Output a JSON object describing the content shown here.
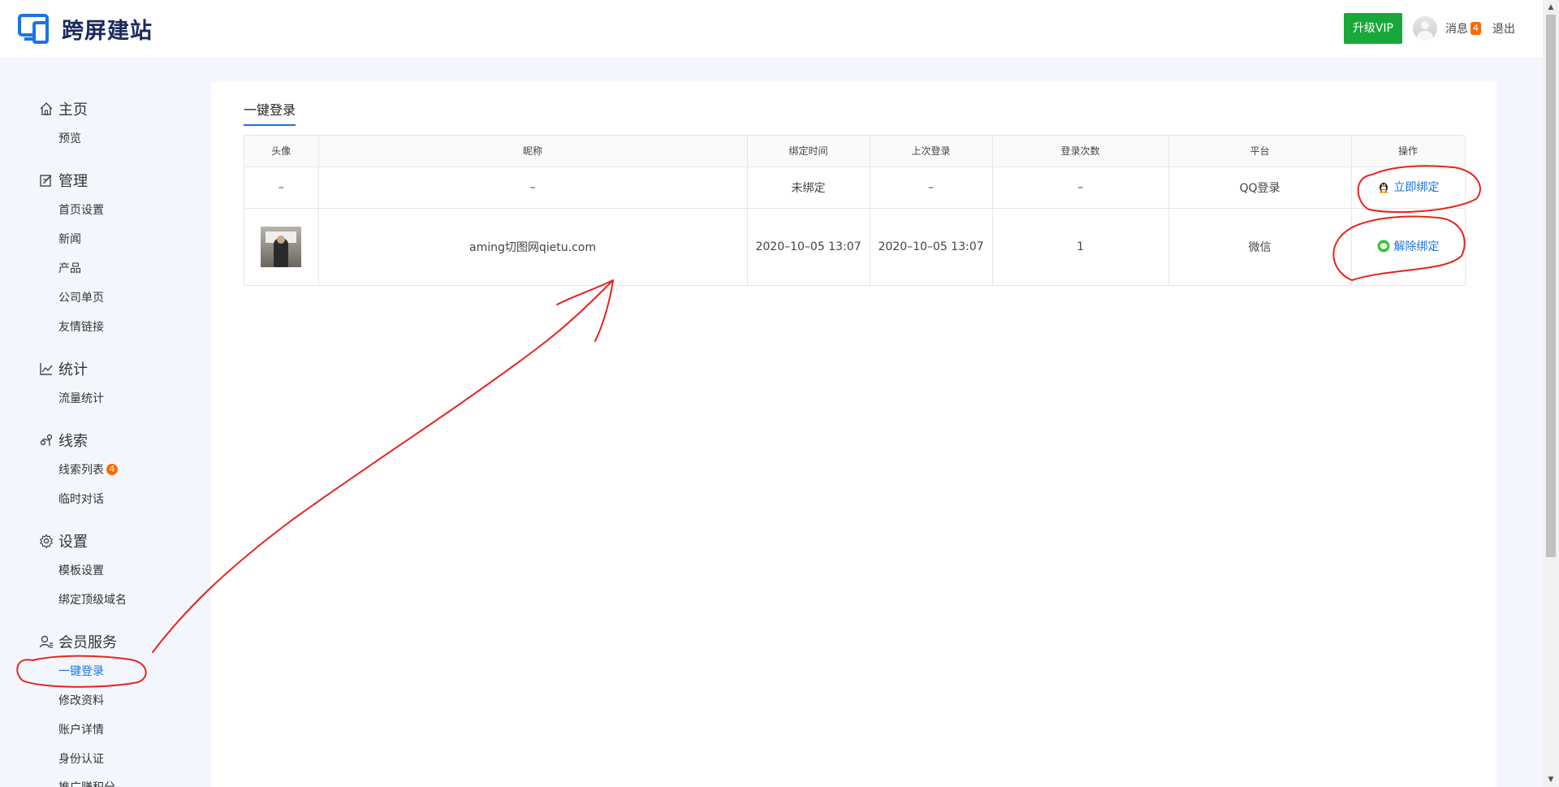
{
  "brand": {
    "name": "跨屏建站"
  },
  "header": {
    "vip_label": "升级VIP",
    "messages_label": "消息",
    "messages_count": "4",
    "logout_label": "退出"
  },
  "sidebar": {
    "groups": [
      {
        "title": "主页",
        "icon": "home-icon",
        "items": [
          "预览"
        ]
      },
      {
        "title": "管理",
        "icon": "edit-icon",
        "items": [
          "首页设置",
          "新闻",
          "产品",
          "公司单页",
          "友情链接"
        ]
      },
      {
        "title": "统计",
        "icon": "chart-line-icon",
        "items": [
          "流量统计"
        ]
      },
      {
        "title": "线索",
        "icon": "clue-icon",
        "items": [
          "线索列表",
          "临时对话"
        ],
        "badge": "4"
      },
      {
        "title": "设置",
        "icon": "gear-icon",
        "items": [
          "模板设置",
          "绑定顶级域名"
        ]
      },
      {
        "title": "会员服务",
        "icon": "member-icon",
        "items": [
          "一键登录",
          "修改资料",
          "账户详情",
          "身份认证",
          "推广赚积分"
        ]
      }
    ],
    "active_item": "一键登录"
  },
  "main": {
    "tab_label": "一键登录",
    "table": {
      "columns": [
        "头像",
        "昵称",
        "绑定时间",
        "上次登录",
        "登录次数",
        "平台",
        "操作"
      ],
      "rows": [
        {
          "avatar": "–",
          "nickname": "–",
          "bind_time": "未绑定",
          "last_login": "–",
          "login_count": "–",
          "platform": "QQ登录",
          "action": "立即绑定",
          "action_icon": "qq-penguin-icon"
        },
        {
          "avatar": "photo",
          "nickname": "aming切图网qietu.com",
          "bind_time": "2020–10–05 13:07",
          "last_login": "2020–10–05 13:07",
          "login_count": "1",
          "platform": "微信",
          "action": "解除绑定",
          "action_icon": "wechat-icon"
        }
      ]
    }
  },
  "colors": {
    "brand_blue": "#1a73e8",
    "vip_green": "#18a83a",
    "badge_orange": "#ff6a00",
    "annotation_red": "#e8231c"
  }
}
